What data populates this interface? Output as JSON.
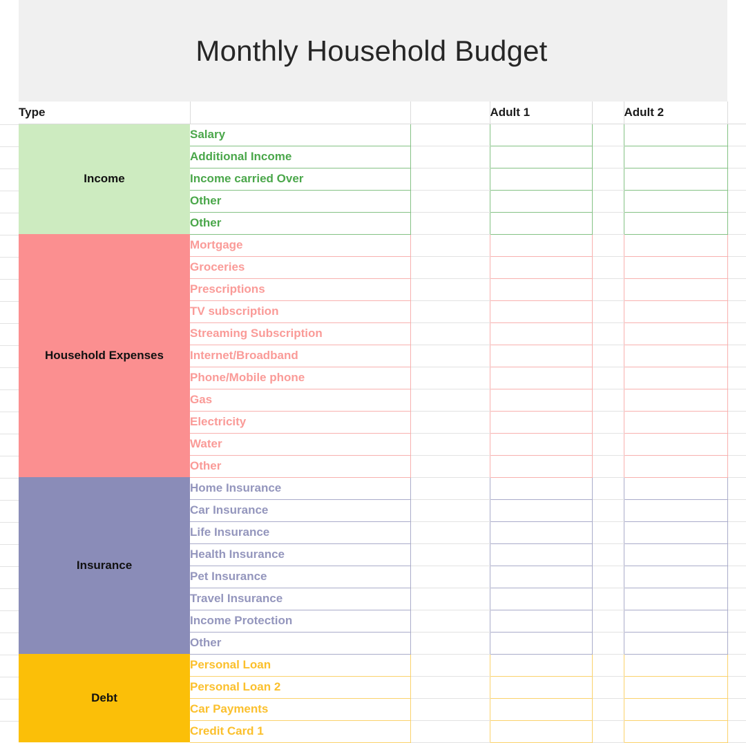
{
  "document": {
    "title": "Monthly Household Budget"
  },
  "table": {
    "header": {
      "type_label": "Type",
      "item_label": "",
      "gap_label": "",
      "adult1_label": "Adult 1",
      "adult2_label": "Adult 2"
    },
    "sections": [
      {
        "key": "income",
        "name": "Income",
        "color": "#cdebc0",
        "text_color": "#4ba74b",
        "border_color": "#83c183",
        "rows": [
          {
            "label": "Salary",
            "adult1": "",
            "adult2": ""
          },
          {
            "label": "Additional Income",
            "adult1": "",
            "adult2": ""
          },
          {
            "label": "Income carried Over",
            "adult1": "",
            "adult2": ""
          },
          {
            "label": "Other",
            "adult1": "",
            "adult2": ""
          },
          {
            "label": "Other",
            "adult1": "",
            "adult2": "",
            "no_top_rule": true
          }
        ]
      },
      {
        "key": "household",
        "name": "Household Expenses",
        "color": "#fb8f90",
        "text_color": "#fa9b98",
        "border_color": "#f8b0ae",
        "rows": [
          {
            "label": "Mortgage",
            "adult1": "",
            "adult2": ""
          },
          {
            "label": "Groceries",
            "adult1": "",
            "adult2": ""
          },
          {
            "label": "Prescriptions",
            "adult1": "",
            "adult2": ""
          },
          {
            "label": "TV subscription",
            "adult1": "",
            "adult2": ""
          },
          {
            "label": "Streaming Subscription",
            "adult1": "",
            "adult2": ""
          },
          {
            "label": "Internet/Broadband",
            "adult1": "",
            "adult2": ""
          },
          {
            "label": "Phone/Mobile phone",
            "adult1": "",
            "adult2": ""
          },
          {
            "label": "Gas",
            "adult1": "",
            "adult2": ""
          },
          {
            "label": "Electricity",
            "adult1": "",
            "adult2": ""
          },
          {
            "label": "Water",
            "adult1": "",
            "adult2": ""
          },
          {
            "label": "Other",
            "adult1": "",
            "adult2": ""
          }
        ]
      },
      {
        "key": "insurance",
        "name": "Insurance",
        "color": "#8a8cb8",
        "text_color": "#9496bd",
        "border_color": "#a9abc9",
        "rows": [
          {
            "label": "Home Insurance",
            "adult1": "",
            "adult2": ""
          },
          {
            "label": "Car Insurance",
            "adult1": "",
            "adult2": ""
          },
          {
            "label": "Life Insurance",
            "adult1": "",
            "adult2": ""
          },
          {
            "label": "Health Insurance",
            "adult1": "",
            "adult2": ""
          },
          {
            "label": "Pet Insurance",
            "adult1": "",
            "adult2": ""
          },
          {
            "label": "Travel Insurance",
            "adult1": "",
            "adult2": ""
          },
          {
            "label": "Income Protection",
            "adult1": "",
            "adult2": ""
          },
          {
            "label": "Other",
            "adult1": "",
            "adult2": ""
          }
        ]
      },
      {
        "key": "debt",
        "name": "Debt",
        "color": "#fbbf08",
        "text_color": "#fbc02d",
        "border_color": "#fbd26a",
        "rows": [
          {
            "label": "Personal Loan",
            "adult1": "",
            "adult2": ""
          },
          {
            "label": "Personal Loan 2",
            "adult1": "",
            "adult2": ""
          },
          {
            "label": "Car Payments",
            "adult1": "",
            "adult2": ""
          },
          {
            "label": "Credit Card 1",
            "adult1": "",
            "adult2": ""
          }
        ]
      }
    ]
  }
}
